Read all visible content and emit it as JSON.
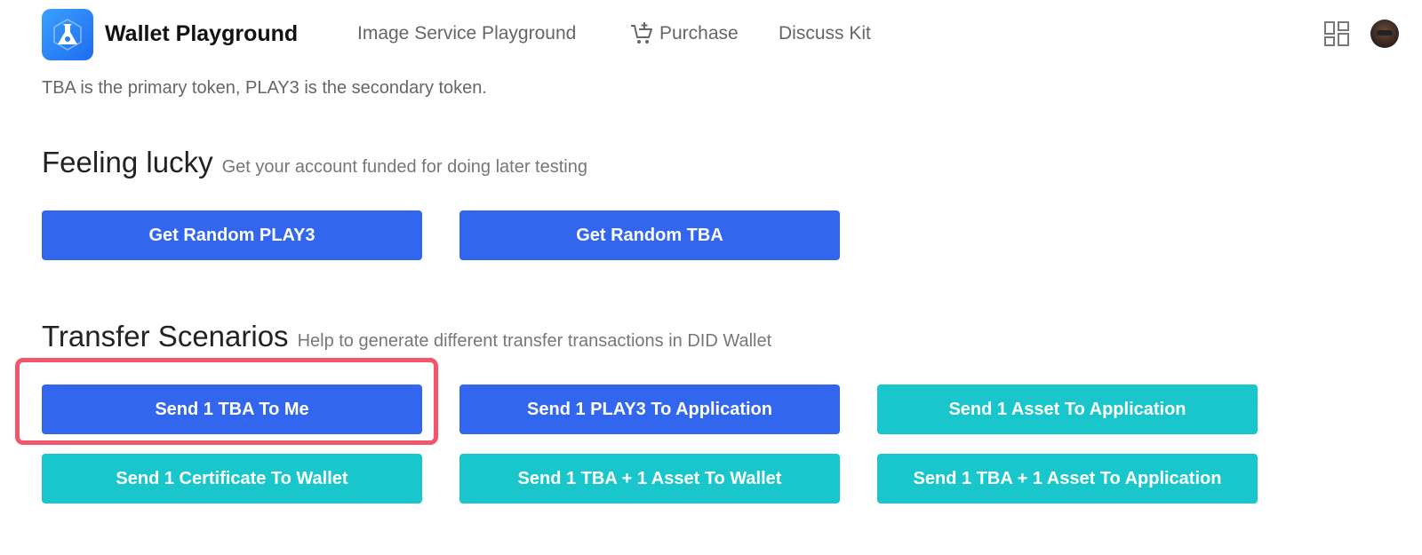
{
  "header": {
    "app_title": "Wallet Playground",
    "nav": [
      {
        "label": "Image Service Playground"
      },
      {
        "label": "Purchase"
      },
      {
        "label": "Discuss Kit"
      }
    ]
  },
  "intro_text": "TBA is the primary token, PLAY3 is the secondary token.",
  "feeling_lucky": {
    "title": "Feeling lucky",
    "subtitle": "Get your account funded for doing later testing",
    "buttons": [
      {
        "label": "Get Random PLAY3"
      },
      {
        "label": "Get Random TBA"
      }
    ]
  },
  "transfer_scenarios": {
    "title": "Transfer Scenarios",
    "subtitle": "Help to generate different transfer transactions in DID Wallet",
    "buttons": [
      {
        "label": "Send 1 TBA To Me"
      },
      {
        "label": "Send 1 PLAY3 To Application"
      },
      {
        "label": "Send 1 Asset To Application"
      },
      {
        "label": "Send 1 Certificate To Wallet"
      },
      {
        "label": "Send 1 TBA + 1 Asset To Wallet"
      },
      {
        "label": "Send 1 TBA + 1 Asset To Application"
      }
    ]
  },
  "colors": {
    "primary_button": "#3366ee",
    "secondary_button": "#19c6cc",
    "highlight": "#f2566a"
  }
}
